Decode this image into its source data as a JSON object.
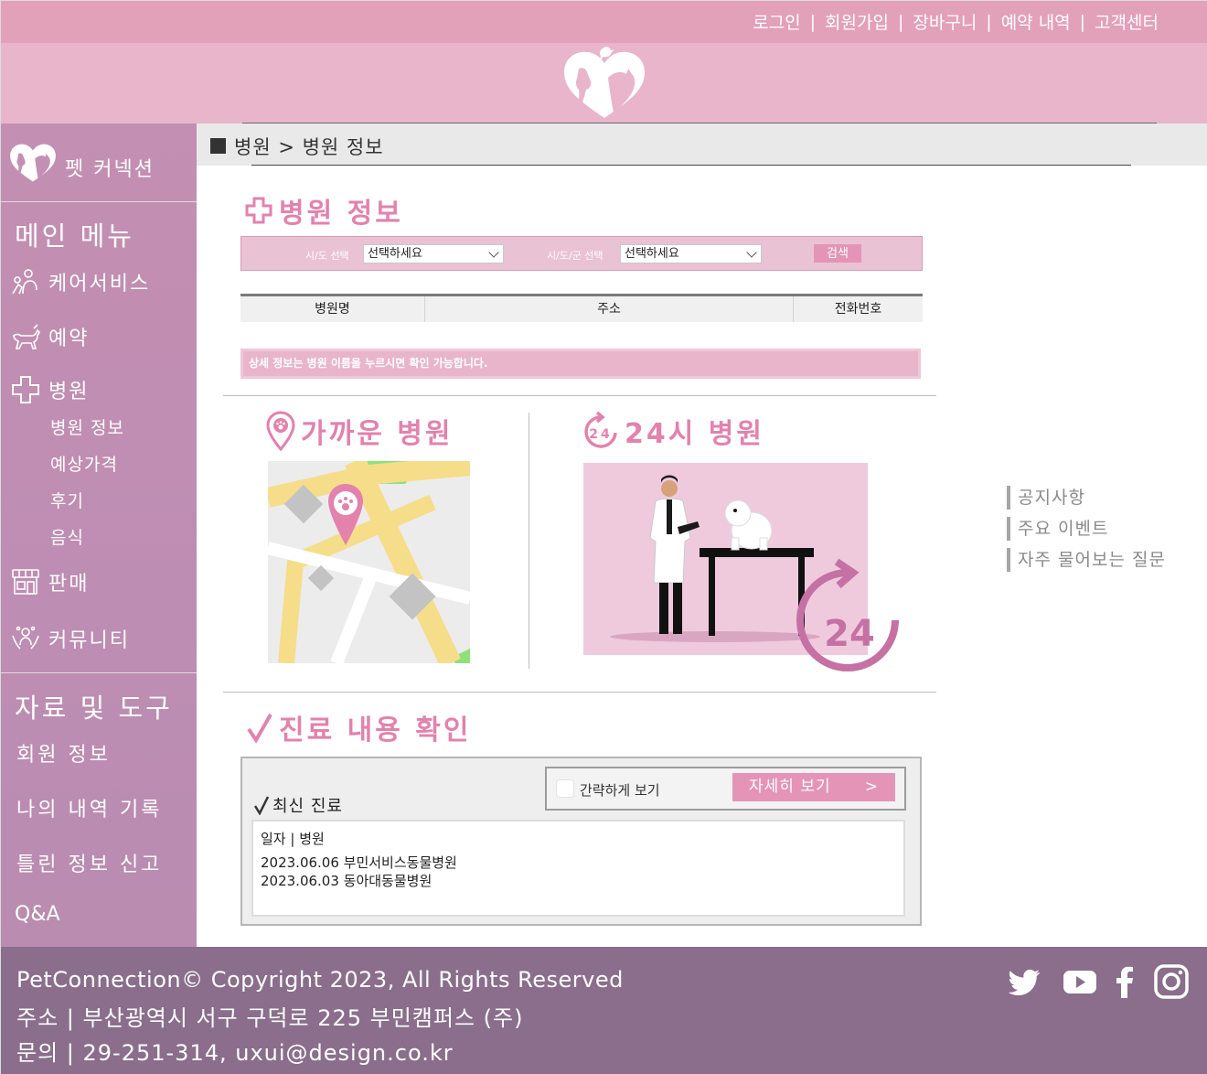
{
  "topnav": {
    "items": [
      "로그인",
      "회원가입",
      "장바구니",
      "예약 내역",
      "고객센터"
    ],
    "separator": "|"
  },
  "sidebar": {
    "brand": "펫 커넥션",
    "main_menu_title": "메인 메뉴",
    "items": [
      {
        "label": "케어서비스",
        "icon": "care-service-icon"
      },
      {
        "label": "예약",
        "icon": "dog-walk-icon"
      },
      {
        "label": "병원",
        "icon": "hospital-cross-icon"
      }
    ],
    "hospital_sub": [
      "병원 정보",
      "예상가격",
      "후기",
      "음식"
    ],
    "items2": [
      {
        "label": "판매",
        "icon": "store-icon"
      },
      {
        "label": "커뮤니티",
        "icon": "community-icon"
      }
    ],
    "tools_title": "자료 및 도구",
    "tools": [
      "회원 정보",
      "나의 내역 기록",
      "틀린 정보 신고",
      "Q&A"
    ]
  },
  "breadcrumb": "병원 > 병원 정보",
  "hospital_info": {
    "title": "병원 정보",
    "search": {
      "label1": "시/도 선택",
      "select1": "선택하세요",
      "label2": "시/도/군 선택",
      "select2": "선택하세요",
      "button": "검색"
    },
    "table_headers": [
      "병원명",
      "주소",
      "전화번호"
    ],
    "notice": "상세 정보는 병원 이름을 누르시면 확인 가능합니다."
  },
  "nearby": {
    "title": "가까운 병원"
  },
  "hours24": {
    "title": "24시 병원",
    "badge": "24"
  },
  "treatment": {
    "title": "진료 내용 확인",
    "checkbox_label": "간략하게 보기",
    "detail_button": "자세히 보기",
    "detail_arrow": ">",
    "recent_label": "최신 진료",
    "records_header": "일자 | 병원",
    "records": [
      "2023.06.06 부민서비스동물병원",
      "2023.06.03 동아대동물병원"
    ]
  },
  "right_links": [
    "공지사항",
    "주요 이벤트",
    "자주 물어보는 질문"
  ],
  "footer": {
    "copyright": "PetConnection© Copyright 2023, All Rights Reserved",
    "address": "주소 | 부산광역시 서구 구덕로 225 부민캠퍼스 (주)",
    "contact": "문의 | 29-251-314, uxui@design.co.kr",
    "social": [
      "twitter-icon",
      "youtube-icon",
      "facebook-icon",
      "instagram-icon"
    ]
  },
  "colors": {
    "accent": "#e282ad",
    "topbar": "#e3a0b9",
    "header": "#e8b5cb",
    "sidebar": "#c38fb2",
    "footer": "#8a6e8c"
  }
}
